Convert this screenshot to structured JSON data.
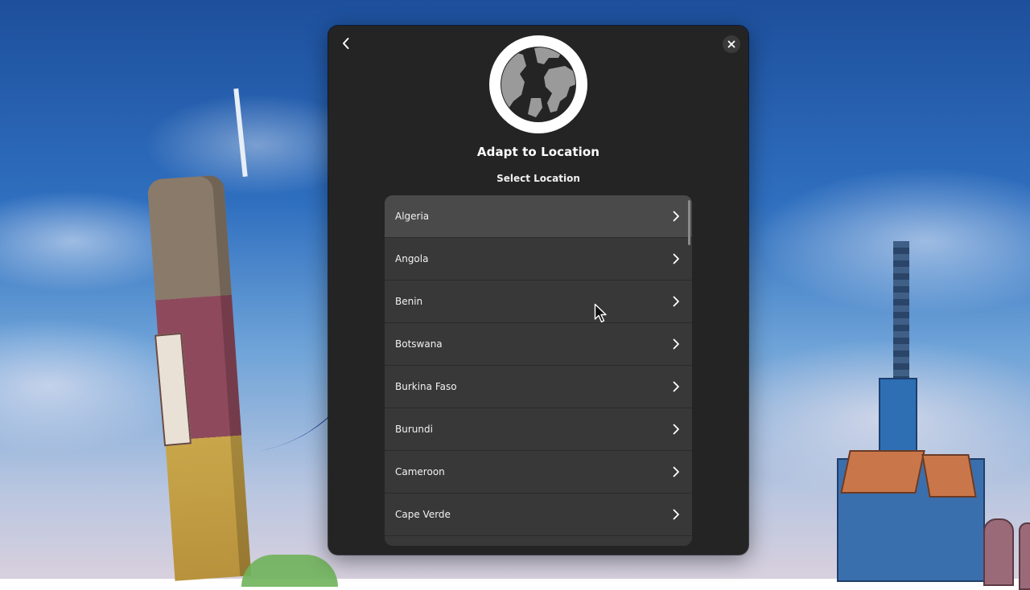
{
  "dialog": {
    "title": "Adapt to Location",
    "subtitle": "Select Location",
    "icons": {
      "back": "chevron-left-icon",
      "close": "close-icon",
      "hero": "globe-icon",
      "row_chevron": "chevron-right-icon"
    },
    "locations": [
      "Algeria",
      "Angola",
      "Benin",
      "Botswana",
      "Burkina Faso",
      "Burundi",
      "Cameroon",
      "Cape Verde"
    ]
  },
  "colors": {
    "dialog_bg": "#242424",
    "list_bg": "#383838",
    "row_hover": "#4a4a4a",
    "text": "#ffffff"
  }
}
